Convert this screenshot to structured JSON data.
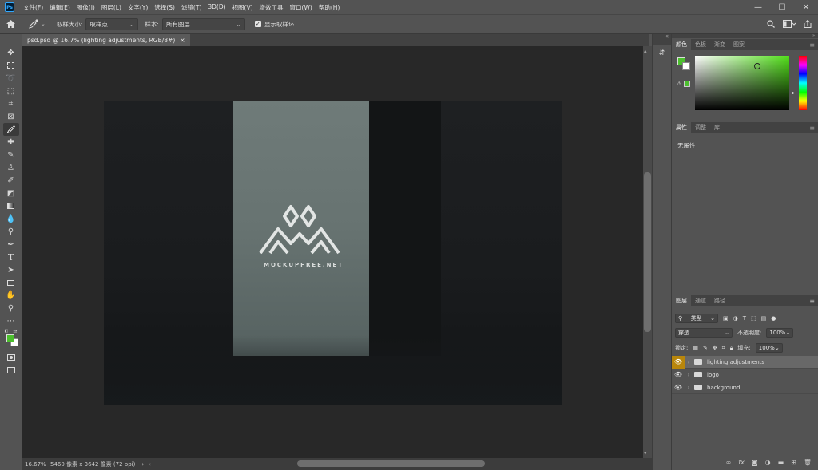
{
  "app": {
    "logo": "Ps"
  },
  "menu": [
    "文件(F)",
    "编辑(E)",
    "图像(I)",
    "图层(L)",
    "文字(Y)",
    "选择(S)",
    "滤镜(T)",
    "3D(D)",
    "视图(V)",
    "增效工具",
    "窗口(W)",
    "帮助(H)"
  ],
  "window_controls": {
    "minimize": "—",
    "maximize": "☐",
    "close": "✕"
  },
  "options": {
    "sample_size_label": "取样大小:",
    "sample_size_value": "取样点",
    "sample_label": "样本:",
    "sample_value": "所有图层",
    "show_ring_label": "显示取样环",
    "show_ring_checked": true
  },
  "document": {
    "tab_title": "psd.psd @ 16.7% (lighting adjustments, RGB/8#)",
    "close": "×"
  },
  "canvas": {
    "logo_text": "MOCKUPFREE.NET"
  },
  "status": {
    "zoom": "16.67%",
    "info": "5460 像素 x 3642 像素 (72 ppi)",
    "arrow": "›"
  },
  "color_panel": {
    "tabs": [
      "颜色",
      "色板",
      "渐变",
      "图案"
    ],
    "active_tab": 0,
    "foreground": "#4cbf2e",
    "background": "#ffffff"
  },
  "properties_panel": {
    "tabs": [
      "属性",
      "调整",
      "库"
    ],
    "active_tab": 0,
    "empty_text": "无属性"
  },
  "layers_panel": {
    "tabs": [
      "图层",
      "通道",
      "路径"
    ],
    "active_tab": 0,
    "filter_label": "类型",
    "blend_mode": "穿透",
    "opacity_label": "不透明度:",
    "opacity_value": "100%",
    "lock_label": "锁定:",
    "fill_label": "填充:",
    "fill_value": "100%",
    "layers": [
      {
        "name": "lighting adjustments",
        "selected": true
      },
      {
        "name": "logo",
        "selected": false
      },
      {
        "name": "background",
        "selected": false
      }
    ]
  }
}
